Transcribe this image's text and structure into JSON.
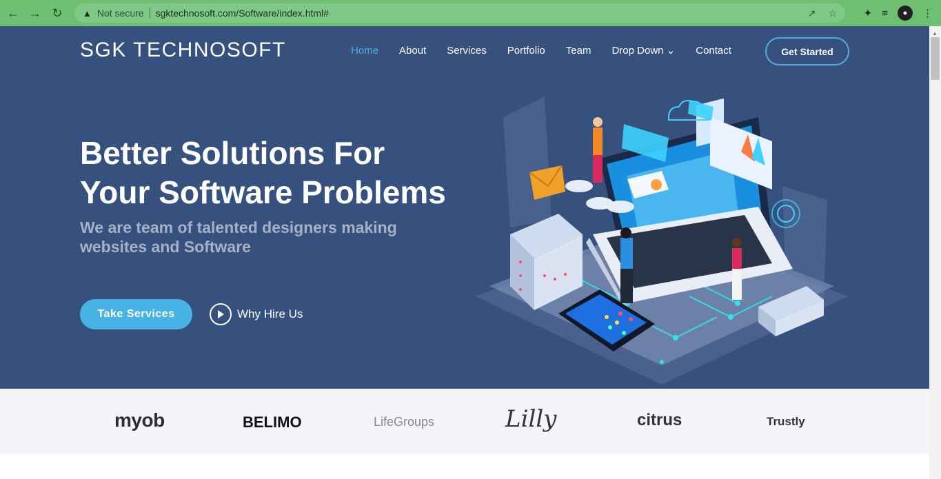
{
  "browser": {
    "not_secure": "Not secure",
    "url": "sgktechnosoft.com/Software/index.html#"
  },
  "site": {
    "brand": "SGK TECHNOSOFT",
    "nav": [
      {
        "label": "Home"
      },
      {
        "label": "About"
      },
      {
        "label": "Services"
      },
      {
        "label": "Portfolio"
      },
      {
        "label": "Team"
      },
      {
        "label": "Drop Down"
      },
      {
        "label": "Contact"
      }
    ],
    "cta": "Get Started"
  },
  "hero": {
    "title_line1": "Better Solutions For",
    "title_line2": "Your Software Problems",
    "subtitle": "We are team of talented designers making websites and Software",
    "primary_button": "Take Services",
    "secondary_link": "Why Hire Us"
  },
  "clients": {
    "logos": [
      "myob",
      "BELIMO",
      "LifeGroups",
      "Lilly",
      "citrus",
      "Trustly"
    ]
  },
  "colors": {
    "hero_bg": "#37517e",
    "accent": "#47b2e4",
    "clients_bg": "#f3f5fa",
    "browser_chrome": "#6fbf73"
  }
}
